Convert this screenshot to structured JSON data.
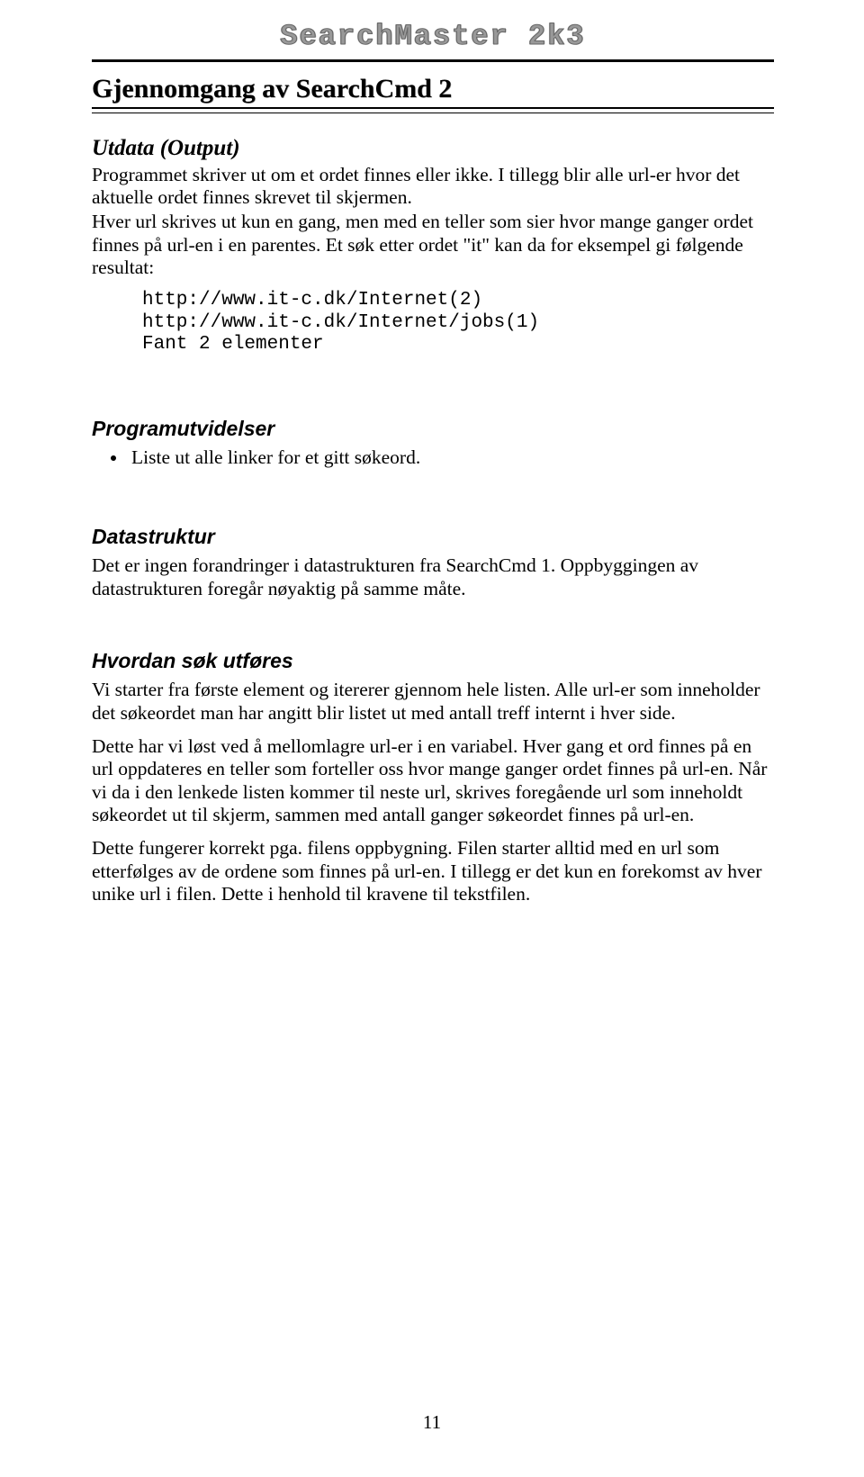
{
  "header": {
    "brand": "SearchMaster 2k3"
  },
  "title": "Gjennomgang av SearchCmd 2",
  "sections": {
    "utdata": {
      "heading": "Utdata (Output)",
      "p1": "Programmet skriver ut om et ordet finnes eller ikke. I tillegg blir alle url-er hvor det aktuelle ordet finnes skrevet til skjermen.",
      "p2": "Hver url skrives ut kun en gang, men med en teller som sier hvor mange ganger ordet finnes på url-en i en parentes. Et søk etter ordet \"it\" kan da for eksempel gi følgende resultat:",
      "code_lines": [
        "http://www.it-c.dk/Internet(2)",
        "http://www.it-c.dk/Internet/jobs(1)",
        "Fant 2 elementer"
      ]
    },
    "programutvidelser": {
      "heading": "Programutvidelser",
      "items": [
        "Liste ut alle linker for et gitt søkeord."
      ]
    },
    "datastruktur": {
      "heading": "Datastruktur",
      "p1": "Det er ingen forandringer i datastrukturen fra SearchCmd 1. Oppbyggingen av datastrukturen foregår nøyaktig på samme måte."
    },
    "hvordan": {
      "heading": "Hvordan søk utføres",
      "p1": "Vi starter fra første element og itererer gjennom hele listen. Alle url-er som inneholder det søkeordet man har angitt blir listet ut med antall treff internt i hver side.",
      "p2": "Dette har vi løst ved å mellomlagre url-er i en variabel. Hver gang et ord finnes på en url oppdateres en teller som forteller oss hvor mange ganger ordet finnes på url-en. Når vi da i den lenkede listen kommer til neste url, skrives foregående url som inneholdt søkeordet ut til skjerm, sammen med antall ganger søkeordet finnes på url-en.",
      "p3": "Dette fungerer korrekt pga. filens oppbygning. Filen starter alltid med en url som etterfølges av de ordene som finnes på url-en. I tillegg er det kun en forekomst av hver unike url i filen. Dette i henhold til kravene til tekstfilen."
    }
  },
  "page_number": "11"
}
